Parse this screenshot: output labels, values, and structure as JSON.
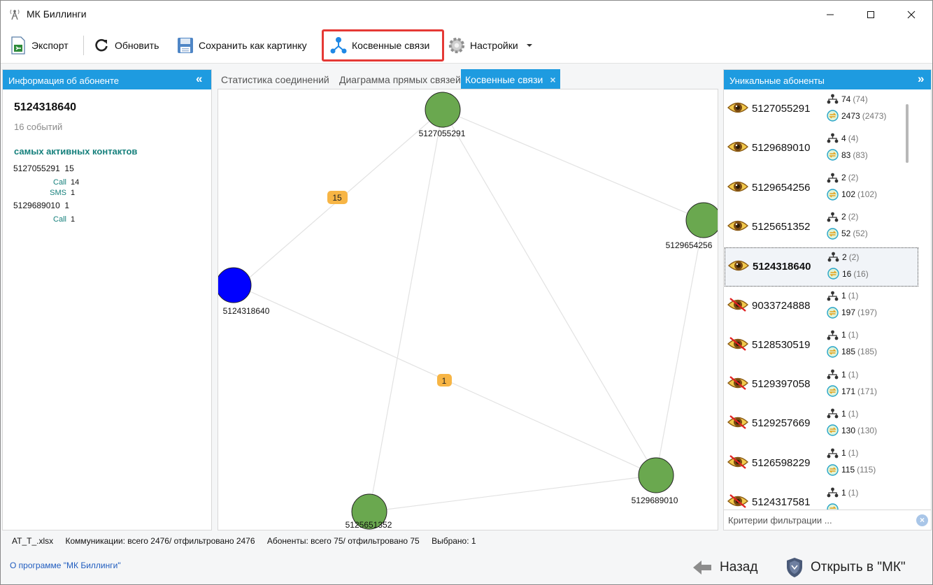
{
  "window": {
    "title": "МК Биллинги"
  },
  "toolbar": {
    "export": "Экспорт",
    "refresh": "Обновить",
    "save_image": "Сохранить как картинку",
    "indirect": "Косвенные связи",
    "settings": "Настройки"
  },
  "left_panel": {
    "header": "Информация об абоненте",
    "number": "5124318640",
    "events": "16 событий",
    "heading": "самых активных контактов",
    "contacts": [
      {
        "number": "5127055291",
        "count": "15",
        "details": [
          {
            "type": "Call",
            "value": "14"
          },
          {
            "type": "SMS",
            "value": "1"
          }
        ]
      },
      {
        "number": "5129689010",
        "count": "1",
        "details": [
          {
            "type": "Call",
            "value": "1"
          }
        ]
      }
    ]
  },
  "tabs": [
    {
      "label": "Статистика соединений"
    },
    {
      "label": "Диаграмма прямых связей"
    },
    {
      "label": "Косвенные связи",
      "close": "×"
    }
  ],
  "graph": {
    "nodes": [
      {
        "label": "5127055291",
        "color": "#6aa84f"
      },
      {
        "label": "5129654256",
        "color": "#6aa84f"
      },
      {
        "label": "5124318640",
        "color": "#0000ff"
      },
      {
        "label": "5129689010",
        "color": "#6aa84f"
      },
      {
        "label": "5125651352",
        "color": "#6aa84f"
      }
    ],
    "edge_labels": [
      "15",
      "1"
    ],
    "badge_color": "#f7b545"
  },
  "right_panel": {
    "header": "Уникальные абоненты",
    "items": [
      {
        "number": "5127055291",
        "visible": true,
        "a": "74",
        "a_paren": "(74)",
        "b": "2473",
        "b_paren": "(2473)"
      },
      {
        "number": "5129689010",
        "visible": true,
        "a": "4",
        "a_paren": "(4)",
        "b": "83",
        "b_paren": "(83)"
      },
      {
        "number": "5129654256",
        "visible": true,
        "a": "2",
        "a_paren": "(2)",
        "b": "102",
        "b_paren": "(102)"
      },
      {
        "number": "5125651352",
        "visible": true,
        "a": "2",
        "a_paren": "(2)",
        "b": "52",
        "b_paren": "(52)"
      },
      {
        "number": "5124318640",
        "visible": true,
        "selected": true,
        "a": "2",
        "a_paren": "(2)",
        "b": "16",
        "b_paren": "(16)"
      },
      {
        "number": "9033724888",
        "visible": false,
        "a": "1",
        "a_paren": "(1)",
        "b": "197",
        "b_paren": "(197)"
      },
      {
        "number": "5128530519",
        "visible": false,
        "a": "1",
        "a_paren": "(1)",
        "b": "185",
        "b_paren": "(185)"
      },
      {
        "number": "5129397058",
        "visible": false,
        "a": "1",
        "a_paren": "(1)",
        "b": "171",
        "b_paren": "(171)"
      },
      {
        "number": "5129257669",
        "visible": false,
        "a": "1",
        "a_paren": "(1)",
        "b": "130",
        "b_paren": "(130)"
      },
      {
        "number": "5126598229",
        "visible": false,
        "a": "1",
        "a_paren": "(1)",
        "b": "115",
        "b_paren": "(115)"
      },
      {
        "number": "5124317581",
        "visible": false,
        "a": "1",
        "a_paren": "(1)",
        "b": "",
        "b_paren": ""
      }
    ],
    "filter_placeholder": "Критерии фильтрации ..."
  },
  "status": {
    "file": "AT_T_.xlsx",
    "communications": "Коммуникации: всего 2476/ отфильтровано 2476",
    "subscribers": "Абоненты: всего 75/ отфильтровано 75",
    "selected": "Выбрано: 1"
  },
  "bottom": {
    "about": "О программе \"МК Биллинги\"",
    "back": "Назад",
    "open": "Открыть в \"МК\""
  },
  "colors": {
    "accent": "#1e9be0",
    "highlight": "#e53935",
    "teal": "#16807c"
  }
}
